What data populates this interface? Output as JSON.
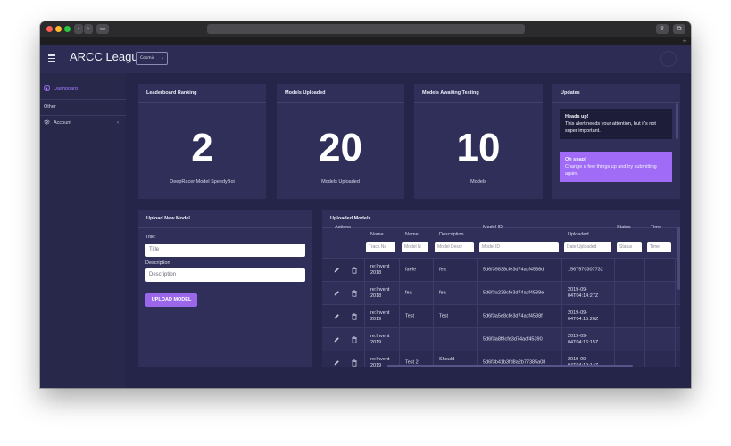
{
  "app": {
    "title": "ARCC League",
    "selector_value": "Cosmic"
  },
  "sidebar": {
    "items": [
      {
        "label": "Dashboard"
      },
      {
        "label": "Other"
      },
      {
        "label": "Account"
      }
    ]
  },
  "cards": {
    "ranking": {
      "title": "Leaderboard Ranking",
      "value": "2",
      "caption": "DeepRacer Model SpeedyBoi"
    },
    "uploaded": {
      "title": "Models Uploaded",
      "value": "20",
      "caption": "Models Uploaded"
    },
    "awaiting": {
      "title": "Models Awaiting Testing",
      "value": "10",
      "caption": "Models"
    }
  },
  "updates": {
    "title": "Updates",
    "alerts": [
      {
        "heading": "Heads up!",
        "body": "This alert needs your attention, but it's not super important."
      },
      {
        "heading": "Oh snap!",
        "body": "Change a few things up and try submitting again."
      }
    ]
  },
  "upload_form": {
    "title": "Upload New Model",
    "title_label": "Title:",
    "title_placeholder": "Title",
    "description_label": "Description",
    "description_placeholder": "Description",
    "button": "UPLOAD MODEL"
  },
  "models_table": {
    "title": "Uploaded Models",
    "headers": [
      "Actions",
      "Name",
      "Name",
      "Description",
      "Model ID",
      "Uploaded",
      "Status",
      "Time"
    ],
    "filters": [
      "Track Na",
      "Model N",
      "Model Descr",
      "Model ID",
      "Date Uploaded",
      "Status",
      "Time"
    ],
    "rows": [
      {
        "track": [
          "re:Invent",
          "2018"
        ],
        "name": "faefe",
        "description": [
          "fea"
        ],
        "model_id": "5d6f39838cfe3d74acf4538d",
        "uploaded": [
          "1567570307732"
        ]
      },
      {
        "track": [
          "re:Invent",
          "2018"
        ],
        "name": "fea",
        "description": [
          "fea"
        ],
        "model_id": "5d6f3a238cfe3d74acf4538e",
        "uploaded": [
          "2019-09-",
          "04T04:14:27Z"
        ]
      },
      {
        "track": [
          "re:Invent",
          "2019"
        ],
        "name": "Test",
        "description": [
          "Test"
        ],
        "model_id": "5d6f3a5e8cfe3d74acf4538f",
        "uploaded": [
          "2019-09-",
          "04T04:15:26Z"
        ]
      },
      {
        "track": [
          "re:Invent",
          "2019"
        ],
        "name": "",
        "description": [
          ""
        ],
        "model_id": "5d6f3a8f8cfe3d74acf45390",
        "uploaded": [
          "2019-09-",
          "04T04:16:15Z"
        ]
      },
      {
        "track": [
          "re:Invent",
          "2019"
        ],
        "name": "Test 2",
        "description": [
          "Should",
          "..."
        ],
        "model_id": "5d6f3b41b3fd8a2b77385a08",
        "uploaded": [
          "2019-09-",
          "04T04:19:14Z"
        ]
      }
    ]
  }
}
